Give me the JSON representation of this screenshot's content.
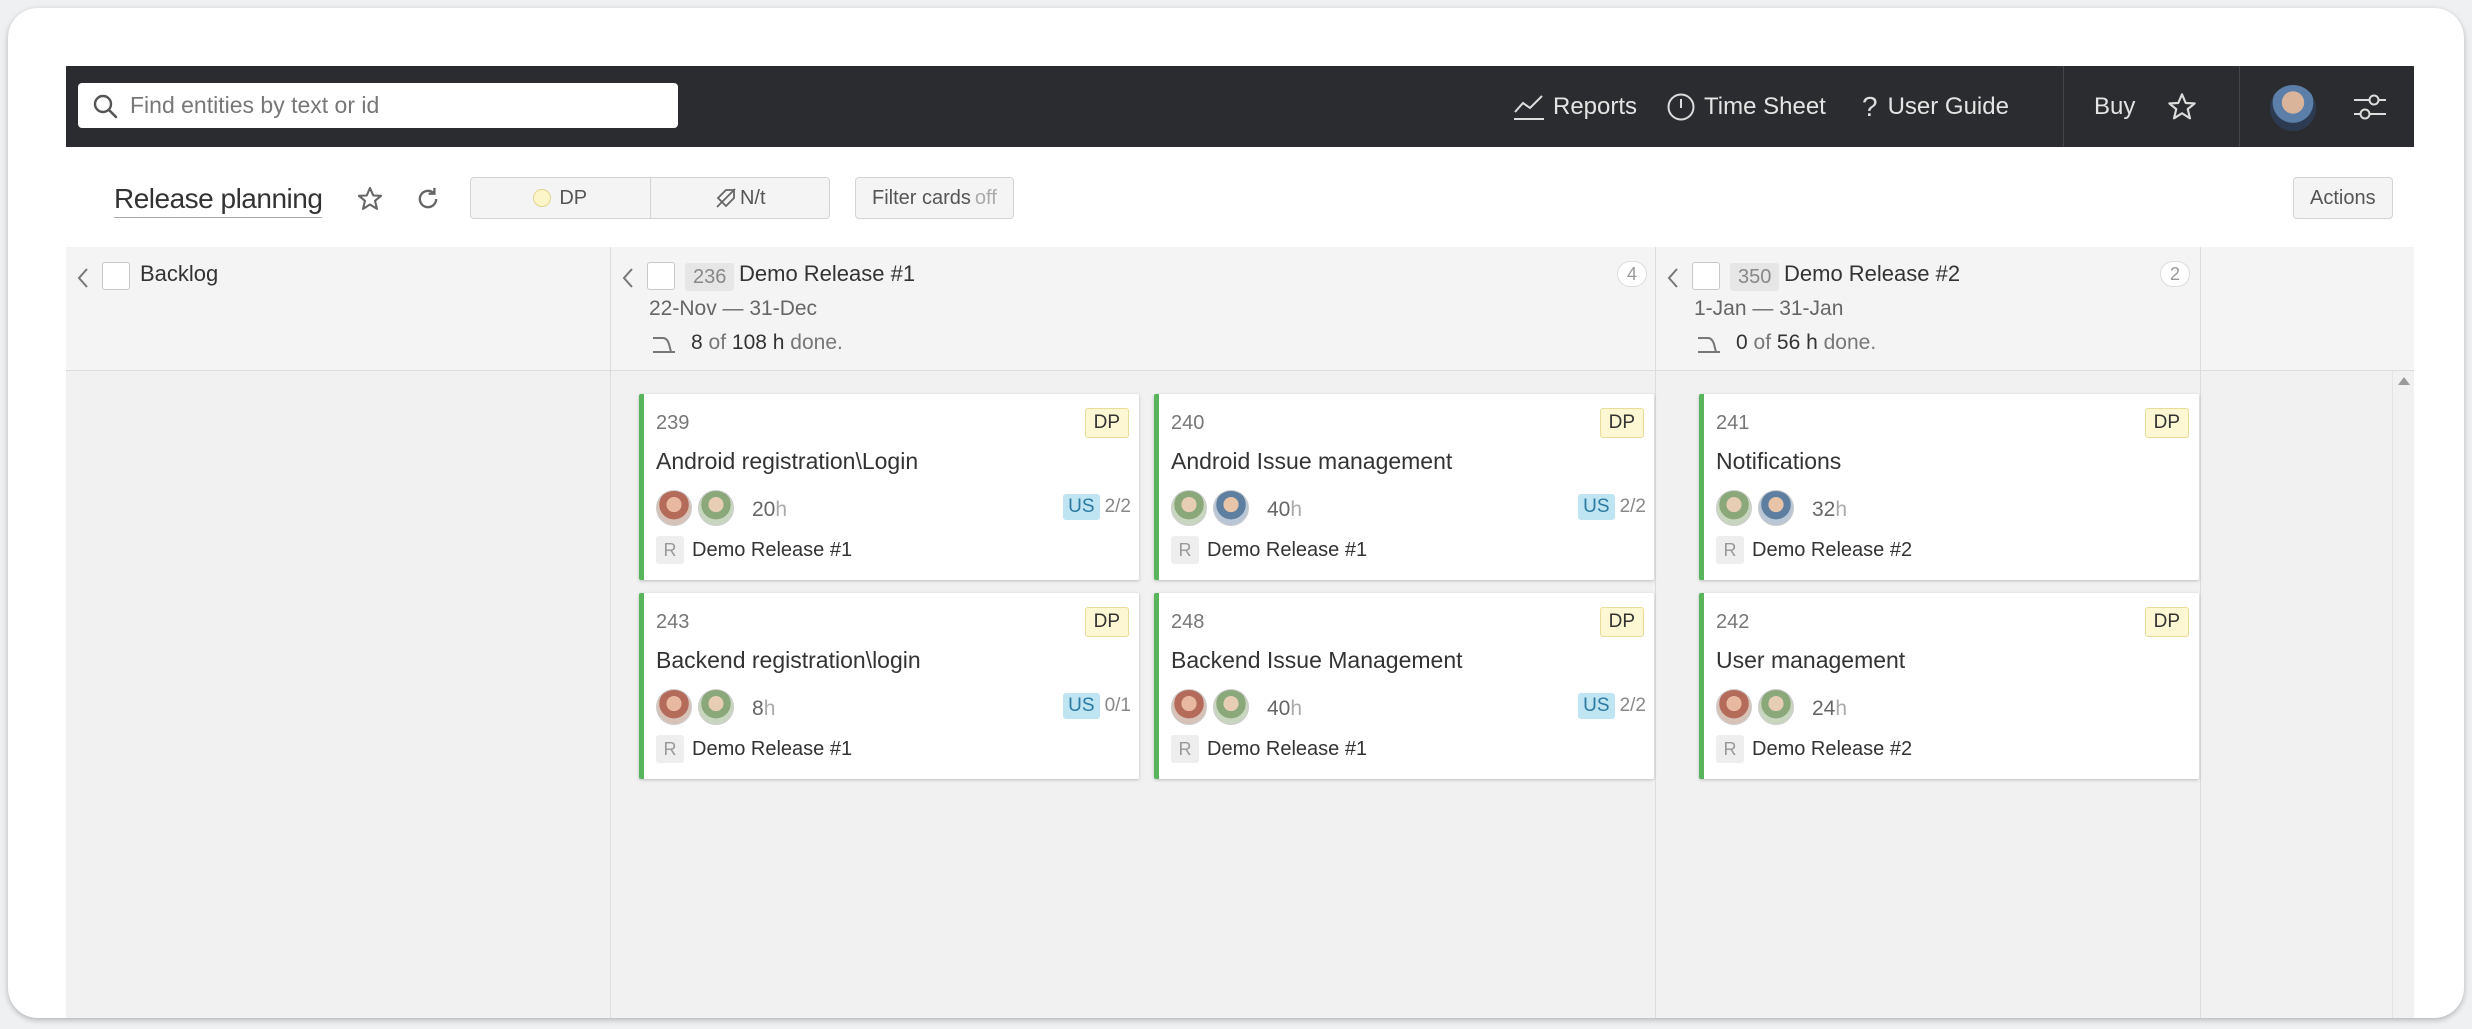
{
  "topbar": {
    "search_placeholder": "Find entities by text or id",
    "reports": "Reports",
    "time_sheet": "Time Sheet",
    "user_guide": "User Guide",
    "buy": "Buy"
  },
  "toolbar": {
    "title": "Release planning",
    "segment_dp": "DP",
    "segment_nt": "N/t",
    "filter_label": "Filter cards",
    "filter_state": "off",
    "actions": "Actions"
  },
  "columns": [
    {
      "name": "Backlog"
    },
    {
      "id": "236",
      "name": "Demo Release #1",
      "count": "4",
      "dates": "22-Nov — 31-Dec",
      "done": "8",
      "total": "108 h"
    },
    {
      "id": "350",
      "name": "Demo Release #2",
      "count": "2",
      "dates": "1-Jan — 31-Jan",
      "done": "0",
      "total": "56 h"
    }
  ],
  "progress_text": {
    "of": "of",
    "done": "done."
  },
  "cards": [
    {
      "id": "239",
      "badge": "DP",
      "name": "Android registration\\Login",
      "hours": "20",
      "unit": "h",
      "us": "US",
      "us_count": "2/2",
      "rel_tag": "R",
      "release": "Demo Release #1"
    },
    {
      "id": "240",
      "badge": "DP",
      "name": "Android Issue management",
      "hours": "40",
      "unit": "h",
      "us": "US",
      "us_count": "2/2",
      "rel_tag": "R",
      "release": "Demo Release #1"
    },
    {
      "id": "243",
      "badge": "DP",
      "name": "Backend registration\\login",
      "hours": "8",
      "unit": "h",
      "us": "US",
      "us_count": "0/1",
      "rel_tag": "R",
      "release": "Demo Release #1"
    },
    {
      "id": "248",
      "badge": "DP",
      "name": "Backend Issue Management",
      "hours": "40",
      "unit": "h",
      "us": "US",
      "us_count": "2/2",
      "rel_tag": "R",
      "release": "Demo Release #1"
    },
    {
      "id": "241",
      "badge": "DP",
      "name": "Notifications",
      "hours": "32",
      "unit": "h",
      "rel_tag": "R",
      "release": "Demo Release #2"
    },
    {
      "id": "242",
      "badge": "DP",
      "name": "User management",
      "hours": "24",
      "unit": "h",
      "rel_tag": "R",
      "release": "Demo Release #2"
    }
  ]
}
